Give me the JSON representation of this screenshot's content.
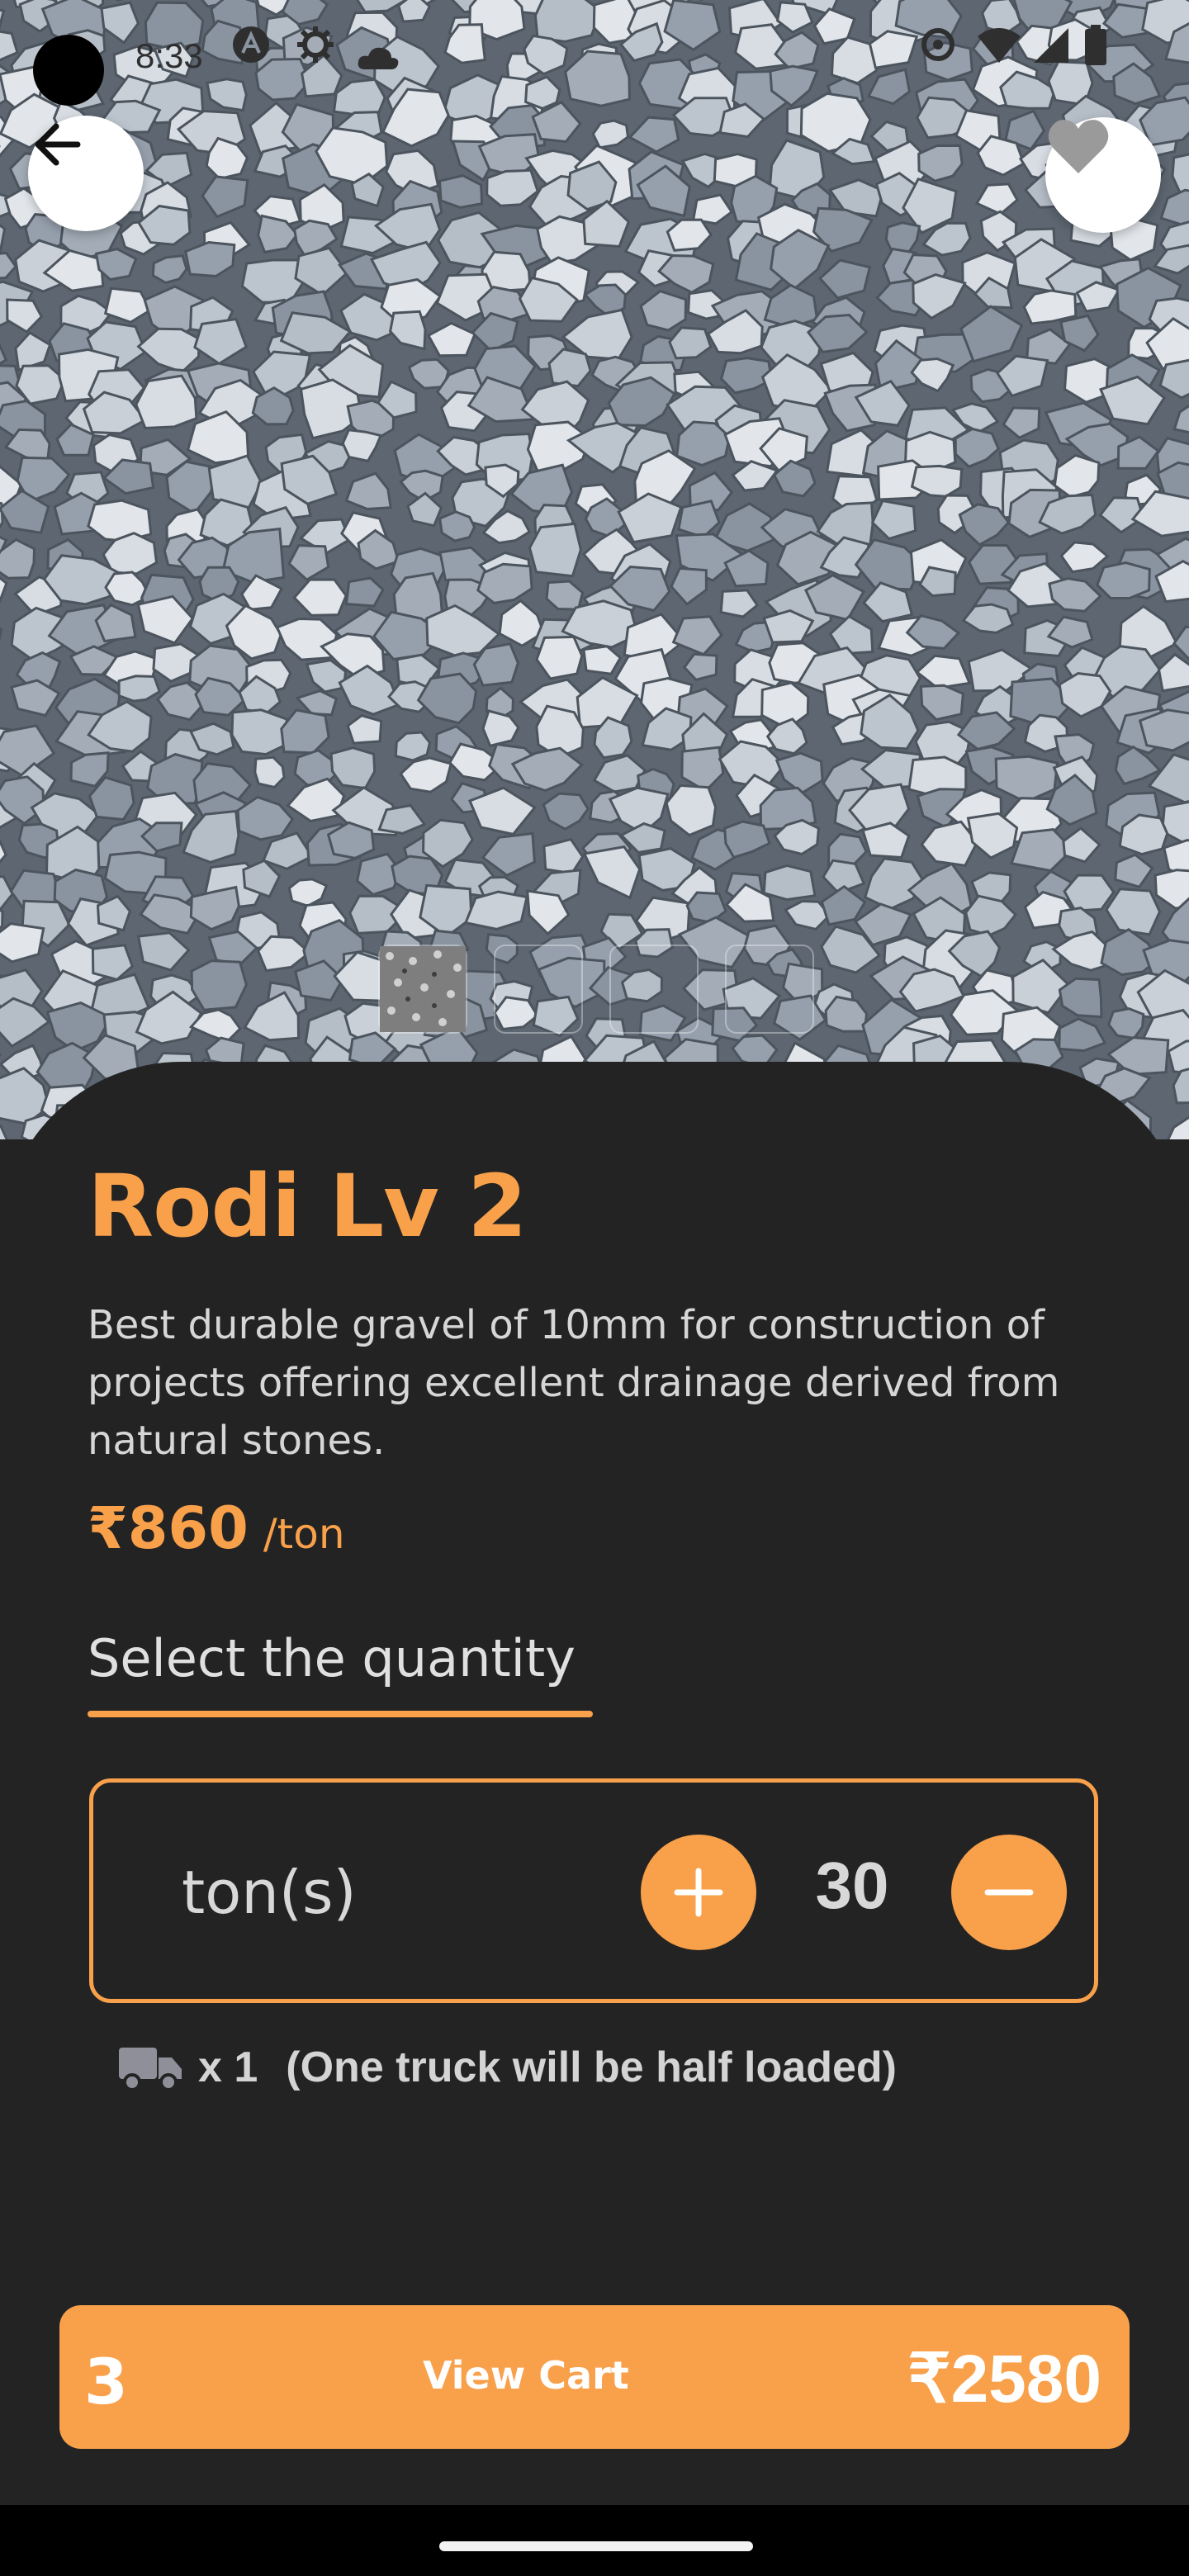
{
  "status_bar": {
    "time": "8:33",
    "icons": [
      "a-icon",
      "gear-icon",
      "cloud-icon",
      "data-saver-icon",
      "wifi-icon",
      "signal-icon",
      "battery-icon"
    ]
  },
  "header": {
    "back_icon": "arrow-left-icon",
    "favorite_icon": "heart-icon"
  },
  "gallery": {
    "thumbnails": [
      "gravel-thumb-1",
      "gravel-thumb-2",
      "gravel-thumb-3",
      "gravel-thumb-4"
    ]
  },
  "product": {
    "title": "Rodi Lv 2",
    "description": "Best durable gravel of 10mm for construction of projects offering excellent drainage derived from natural stones.",
    "price": "₹860",
    "price_unit": "/ton"
  },
  "quantity": {
    "heading": "Select the quantity",
    "unit": "ton(s)",
    "value": "30"
  },
  "truck_info": {
    "count": "x 1",
    "note": "(One truck will be half loaded)"
  },
  "cart": {
    "count": "3",
    "label": "View Cart",
    "total": "₹2580"
  },
  "colors": {
    "accent": "#f9a04a",
    "background": "#232323",
    "text_light": "#d6d6d6"
  }
}
